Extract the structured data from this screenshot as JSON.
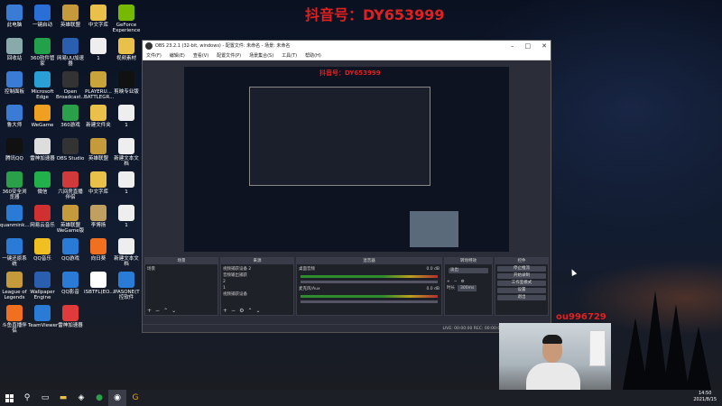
{
  "overlay": {
    "title": "抖音号：DY653999",
    "webcam_label": "ou996729"
  },
  "desktop_icons": [
    {
      "label": "此电脑",
      "icon": "computer-icon",
      "color": "#3a7bd5"
    },
    {
      "label": "一键启动",
      "icon": "app-icon",
      "color": "#2a6fd6"
    },
    {
      "label": "英雄联盟",
      "icon": "lol-icon",
      "color": "#c49a3a"
    },
    {
      "label": "中文字库",
      "icon": "folder-icon",
      "color": "#e8c04a"
    },
    {
      "label": "GeForce Experience",
      "icon": "nvidia-icon",
      "color": "#76b900"
    },
    {
      "label": "回收站",
      "icon": "recycle-bin-icon",
      "color": "#8aa"
    },
    {
      "label": "360软件管家",
      "icon": "app-icon",
      "color": "#22a04a"
    },
    {
      "label": "网易UU加速器",
      "icon": "app-icon",
      "color": "#2a5fb0"
    },
    {
      "label": "1",
      "icon": "file-icon",
      "color": "#eee"
    },
    {
      "label": "视频素材",
      "icon": "folder-icon",
      "color": "#e8c04a"
    },
    {
      "label": "控制面板",
      "icon": "control-panel-icon",
      "color": "#3a7bd5"
    },
    {
      "label": "Microsoft Edge",
      "icon": "edge-icon",
      "color": "#2a9fd6"
    },
    {
      "label": "Open Broadcast...",
      "icon": "obs-icon",
      "color": "#333"
    },
    {
      "label": "PLAYERU... BATTLEGR...",
      "icon": "pubg-icon",
      "color": "#c8a43a"
    },
    {
      "label": "剪映专业版",
      "icon": "app-icon",
      "color": "#111"
    },
    {
      "label": "鲁大师",
      "icon": "app-icon",
      "color": "#3a7bd5"
    },
    {
      "label": "WeGame",
      "icon": "wegame-icon",
      "color": "#f0a020"
    },
    {
      "label": "360游戏",
      "icon": "app-icon",
      "color": "#2aa04a"
    },
    {
      "label": "新建文件夹",
      "icon": "folder-icon",
      "color": "#e8c04a"
    },
    {
      "label": "1",
      "icon": "file-icon",
      "color": "#eee"
    },
    {
      "label": "腾讯QQ",
      "icon": "qq-icon",
      "color": "#111"
    },
    {
      "label": "雷神加速器",
      "icon": "app-icon",
      "color": "#ddd"
    },
    {
      "label": "OBS Studio",
      "icon": "obs-icon",
      "color": "#333"
    },
    {
      "label": "英雄联盟",
      "icon": "lol-icon",
      "color": "#c49a3a"
    },
    {
      "label": "新建文本文档",
      "icon": "text-doc-icon",
      "color": "#eee"
    },
    {
      "label": "360安全浏览器",
      "icon": "browser-icon",
      "color": "#2aa04a"
    },
    {
      "label": "微信",
      "icon": "wechat-icon",
      "color": "#22b04a"
    },
    {
      "label": "六间房直播伴侣",
      "icon": "app-icon",
      "color": "#d03a3a"
    },
    {
      "label": "中文字库",
      "icon": "folder-icon",
      "color": "#e8c04a"
    },
    {
      "label": "1",
      "icon": "file-icon",
      "color": "#eee"
    },
    {
      "label": "quanmink...",
      "icon": "app-icon",
      "color": "#2a7bd5"
    },
    {
      "label": "网易云音乐",
      "icon": "netease-music-icon",
      "color": "#d03030"
    },
    {
      "label": "英雄联盟WeGame版",
      "icon": "lol-icon",
      "color": "#c49a3a"
    },
    {
      "label": "李博扬",
      "icon": "file-icon",
      "color": "#c0a060"
    },
    {
      "label": "1",
      "icon": "file-icon",
      "color": "#eee"
    },
    {
      "label": "一键还原系统",
      "icon": "app-icon",
      "color": "#2a7bd5"
    },
    {
      "label": "QQ音乐",
      "icon": "qq-music-icon",
      "color": "#f0c020"
    },
    {
      "label": "QQ游戏",
      "icon": "app-icon",
      "color": "#2a7bd5"
    },
    {
      "label": "向日葵",
      "icon": "app-icon",
      "color": "#f07020"
    },
    {
      "label": "新建文本文档",
      "icon": "text-doc-icon",
      "color": "#eee"
    },
    {
      "label": "League of Legends",
      "icon": "lol-icon",
      "color": "#c49a3a"
    },
    {
      "label": "Wallpaper Engine",
      "icon": "app-icon",
      "color": "#2a5fb0"
    },
    {
      "label": "QQ影音",
      "icon": "app-icon",
      "color": "#2a7bd5"
    },
    {
      "label": "ISBTFL(EO...",
      "icon": "file-icon",
      "color": "#fff"
    },
    {
      "label": "IPASONE(T控软件",
      "icon": "app-icon",
      "color": "#2a7bd5"
    },
    {
      "label": "斗鱼直播伴侣",
      "icon": "app-icon",
      "color": "#f07020"
    },
    {
      "label": "TeamViewer",
      "icon": "teamviewer-icon",
      "color": "#2a7bd5"
    },
    {
      "label": "雷神加速器",
      "icon": "app-icon",
      "color": "#e03a3a"
    }
  ],
  "obs": {
    "title": "OBS 23.2.1 (32-bit, windows) - 配置文件: 未命名 - 场景: 未命名",
    "menu": [
      "文件(F)",
      "编辑(E)",
      "查看(V)",
      "配置文件(P)",
      "场景集合(S)",
      "工具(T)",
      "帮助(H)"
    ],
    "preview_title": "抖音号：DY653999",
    "panels": {
      "scenes": {
        "head": "场景",
        "items": [
          "场景"
        ]
      },
      "sources": {
        "head": "来源",
        "items": [
          "视频捕获设备 2",
          "音频输出捕获",
          "2",
          "1",
          "视频捕获设备",
          "显示器采集"
        ]
      },
      "mixer": {
        "head": "混音器",
        "channels": [
          "桌面音频",
          "麦克风/Aux"
        ],
        "db": [
          "0.0 dB",
          "0.0 dB"
        ]
      },
      "transitions": {
        "head": "转场特效",
        "type": "淡出",
        "duration_label": "时长",
        "duration": "300ms"
      },
      "controls": {
        "head": "控件",
        "buttons": [
          "停止推流",
          "开始录制",
          "工作室模式",
          "设置",
          "退出"
        ]
      }
    },
    "status": "LIVE: 00:00:00   REC: 00:00:00   CPU: 1.1%, 30.00 fps"
  },
  "taskbar": {
    "time": "14:50",
    "date": "2021/8/15"
  }
}
